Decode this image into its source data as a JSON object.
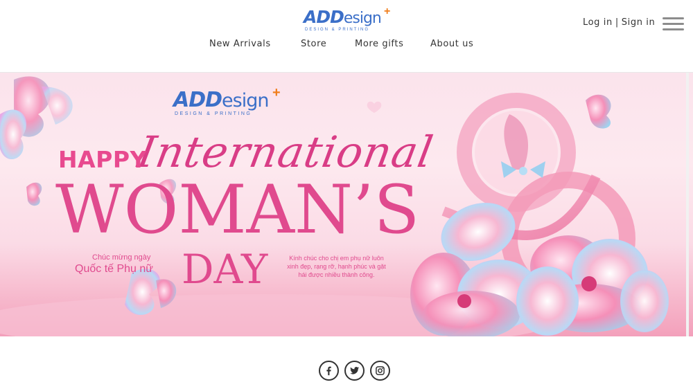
{
  "brand": {
    "logo_main": "ADD",
    "logo_esign": "esign",
    "logo_plus": "+",
    "logo_sub": "DESIGN & PRINTING"
  },
  "nav": {
    "items": [
      {
        "label": "New Arrivals"
      },
      {
        "label": "Store"
      },
      {
        "label": "More gifts"
      },
      {
        "label": "About us"
      }
    ]
  },
  "auth": {
    "login": "Log in",
    "separator": "|",
    "signin": "Sign in"
  },
  "menu": {
    "icon": "hamburger-menu-icon"
  },
  "banner": {
    "happy": "HAPPY",
    "international": "International",
    "womans": "WOMAN’S",
    "day": "DAY",
    "vn_small": "Chúc mừng ngày",
    "vn_big": "Quốc tế Phụ nữ",
    "wish": "Kính chúc cho chị em phụ nữ luôn xinh đẹp, rạng rỡ, hạnh phúc và gặt hái được nhiều thành công."
  },
  "social": [
    {
      "icon": "facebook-icon"
    },
    {
      "icon": "twitter-icon"
    },
    {
      "icon": "instagram-icon"
    }
  ],
  "colors": {
    "brand_blue": "#3b6fc8",
    "brand_orange": "#f07e1c",
    "banner_pink": "#e04a8e"
  }
}
